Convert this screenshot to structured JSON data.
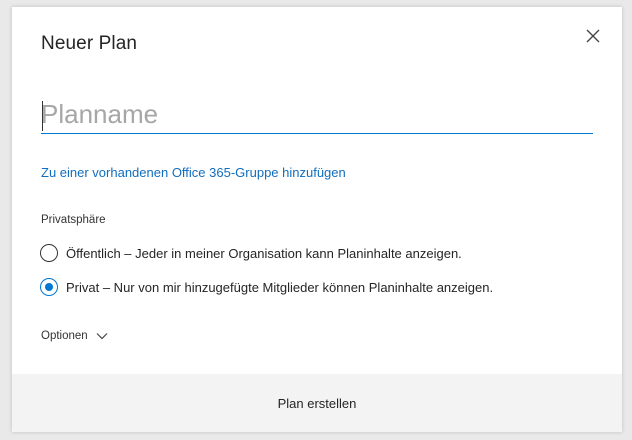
{
  "dialog": {
    "title": "Neuer Plan",
    "close_icon": "close-icon"
  },
  "plan_name": {
    "value": "",
    "placeholder": "Planname"
  },
  "group_link": {
    "label": "Zu einer vorhandenen Office 365-Gruppe hinzufügen"
  },
  "privacy": {
    "label": "Privatsphäre",
    "options": [
      {
        "label": "Öffentlich – Jeder in meiner Organisation kann Planinhalte anzeigen.",
        "selected": false
      },
      {
        "label": "Privat – Nur von mir hinzugefügte Mitglieder können Planinhalte anzeigen.",
        "selected": true
      }
    ]
  },
  "options": {
    "label": "Optionen",
    "icon": "chevron-down-icon"
  },
  "footer": {
    "create_label": "Plan erstellen"
  },
  "colors": {
    "accent": "#0078d4",
    "link": "#106ebe",
    "footer_bg": "#f3f3f3"
  }
}
